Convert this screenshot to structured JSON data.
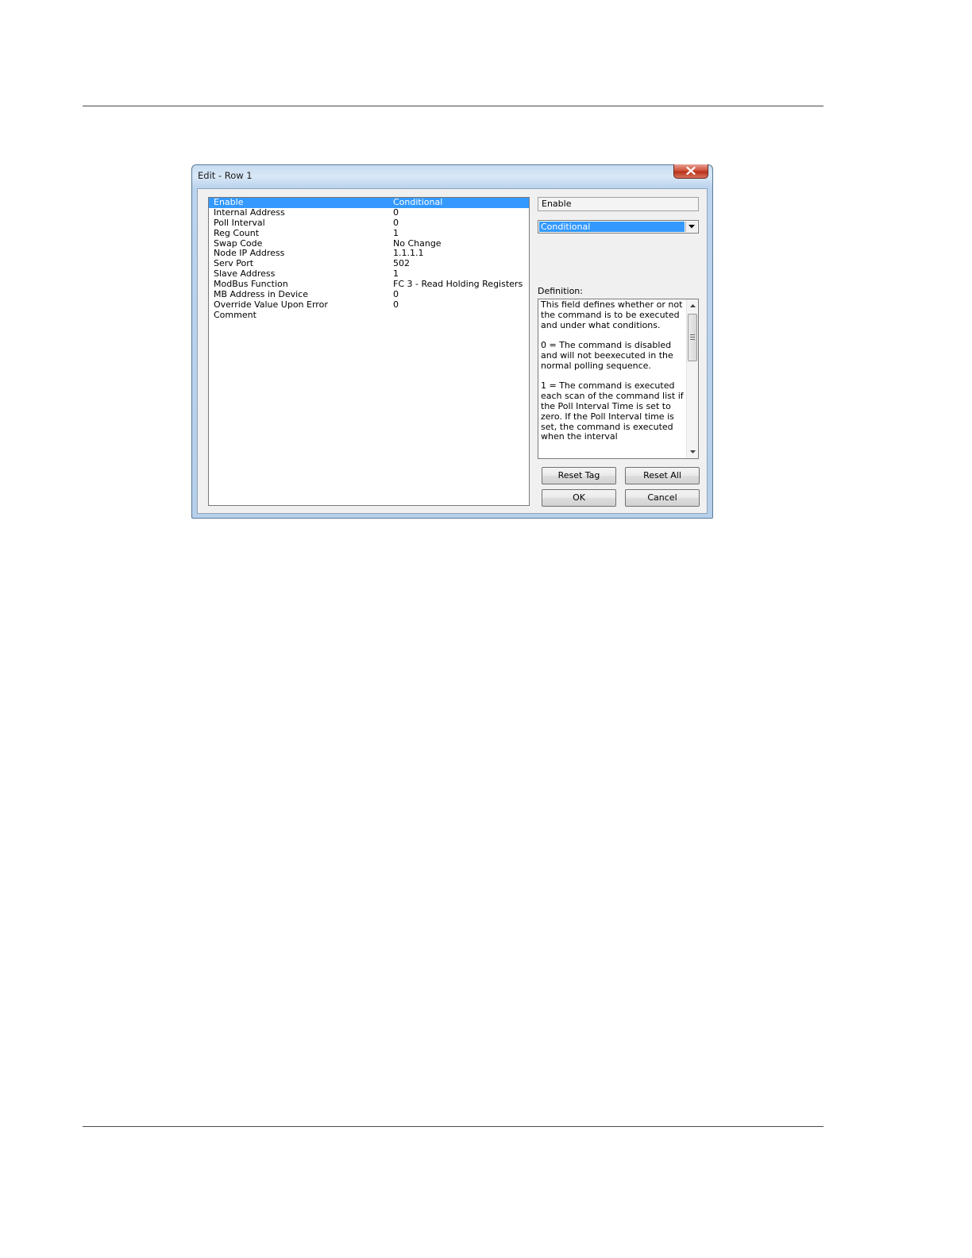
{
  "window": {
    "title": "Edit - Row 1"
  },
  "properties": [
    {
      "key": "Enable",
      "value": "Conditional",
      "selected": true
    },
    {
      "key": "Internal Address",
      "value": "0"
    },
    {
      "key": "Poll Interval",
      "value": "0"
    },
    {
      "key": "Reg Count",
      "value": "1"
    },
    {
      "key": "Swap Code",
      "value": "No Change"
    },
    {
      "key": "Node IP Address",
      "value": "1.1.1.1"
    },
    {
      "key": "Serv Port",
      "value": "502"
    },
    {
      "key": "Slave Address",
      "value": "1"
    },
    {
      "key": "ModBus Function",
      "value": "FC 3 - Read Holding Registers"
    },
    {
      "key": "MB Address in Device",
      "value": "0"
    },
    {
      "key": "Override Value Upon Error",
      "value": "0"
    },
    {
      "key": "Comment",
      "value": ""
    }
  ],
  "editor": {
    "field_name": "Enable",
    "combo_value": "Conditional",
    "definition_label": "Definition:",
    "definition_text": "This field defines whether or not the command is to be executed and under what conditions.\n\n0 = The command is disabled and will not beexecuted in the normal polling sequence.\n\n1 = The command is executed each scan of the command list if the Poll Interval Time is set to zero. If the Poll Interval time is set, the command is executed when the interval"
  },
  "buttons": {
    "reset_tag": "Reset Tag",
    "reset_all": "Reset All",
    "ok": "OK",
    "cancel": "Cancel"
  },
  "icons": {
    "close": "close-icon",
    "dropdown": "chevron-down-icon",
    "scroll_up": "scroll-up-arrow-icon",
    "scroll_down": "scroll-down-arrow-icon"
  },
  "colors": {
    "selection": "#3399ff",
    "close_button": "#c8432a",
    "dialog_face": "#f0f0f0"
  }
}
